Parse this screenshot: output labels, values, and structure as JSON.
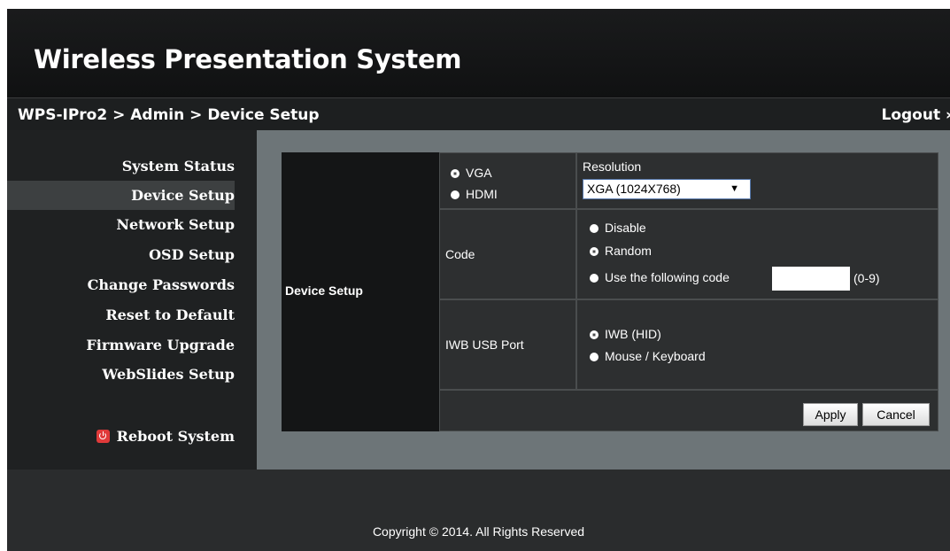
{
  "app": {
    "title": "Wireless Presentation System"
  },
  "breadcrumb": "WPS-IPro2 > Admin > Device Setup",
  "logout_label": "Logout »",
  "sidebar": {
    "items": [
      {
        "label": "System Status"
      },
      {
        "label": "Device Setup",
        "active": true
      },
      {
        "label": "Network Setup"
      },
      {
        "label": "OSD Setup"
      },
      {
        "label": "Change Passwords"
      },
      {
        "label": "Reset to Default"
      },
      {
        "label": "Firmware Upgrade"
      },
      {
        "label": "WebSlides Setup"
      }
    ],
    "reboot_label": "Reboot System",
    "reboot_icon": "power-icon"
  },
  "device_setup": {
    "section_label": "Device Setup",
    "output": {
      "options": [
        {
          "label": "VGA",
          "selected": true
        },
        {
          "label": "HDMI",
          "selected": false
        }
      ],
      "resolution_label": "Resolution",
      "resolution_value": "XGA (1024X768)"
    },
    "code": {
      "label": "Code",
      "options": [
        {
          "label": "Disable",
          "selected": false
        },
        {
          "label": "Random",
          "selected": true
        },
        {
          "label": "Use the following code",
          "selected": false
        }
      ],
      "input_value": "",
      "range_hint": "(0-9)"
    },
    "iwb_usb": {
      "label": "IWB USB Port",
      "options": [
        {
          "label": "IWB (HID)",
          "selected": true
        },
        {
          "label": "Mouse / Keyboard",
          "selected": false
        }
      ]
    },
    "apply_label": "Apply",
    "cancel_label": "Cancel"
  },
  "footer": {
    "copyright": "Copyright © 2014. All Rights Reserved"
  }
}
